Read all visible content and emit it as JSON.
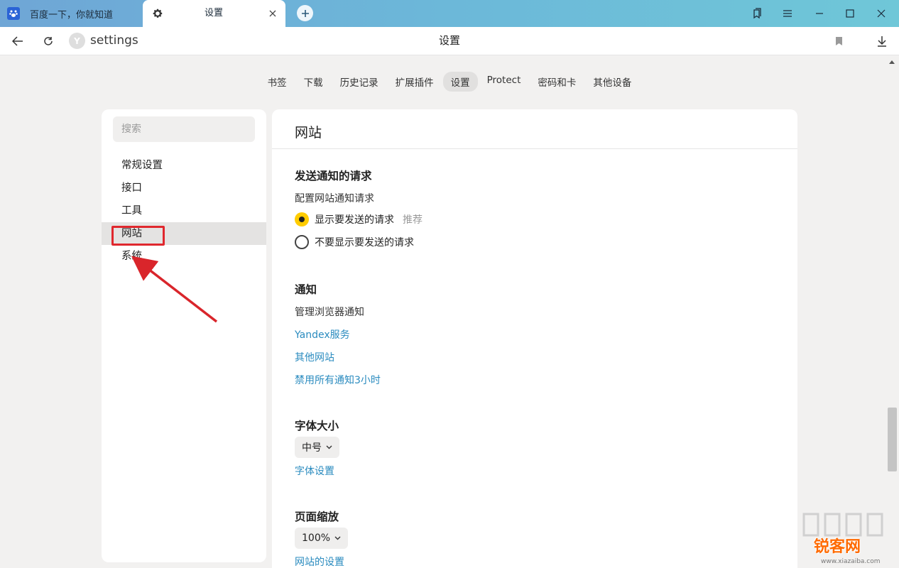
{
  "tabs": [
    {
      "title": "百度一下，你就知道",
      "icon": "baidu-paw-icon"
    },
    {
      "title": "设置",
      "icon": "gear-icon"
    }
  ],
  "address": {
    "site_badge": "Y",
    "url": "settings",
    "page_title": "设置"
  },
  "nav": [
    "书签",
    "下载",
    "历史记录",
    "扩展插件",
    "设置",
    "Protect",
    "密码和卡",
    "其他设备"
  ],
  "nav_active": "设置",
  "sidebar": {
    "search_placeholder": "搜索",
    "items": [
      "常规设置",
      "接口",
      "工具",
      "网站",
      "系统"
    ],
    "selected": "网站"
  },
  "main": {
    "title": "网站",
    "notify_requests": {
      "heading": "发送通知的请求",
      "desc": "配置网站通知请求",
      "option1": "显示要发送的请求",
      "option1_tag": "推荐",
      "option2": "不要显示要发送的请求",
      "selected": "显示要发送的请求"
    },
    "notifications": {
      "heading": "通知",
      "desc": "管理浏览器通知",
      "links": [
        "Yandex服务",
        "其他网站",
        "禁用所有通知3小时"
      ]
    },
    "font_size": {
      "heading": "字体大小",
      "value": "中号",
      "link": "字体设置"
    },
    "zoom": {
      "heading": "页面缩放",
      "value": "100%",
      "link": "网站的设置"
    }
  },
  "watermark": {
    "text": "锐客网",
    "url": "www.xiazaiba.com"
  },
  "colors": {
    "accent": "#ffcc00",
    "link": "#2a8bbf",
    "annotation": "#e0282e"
  }
}
